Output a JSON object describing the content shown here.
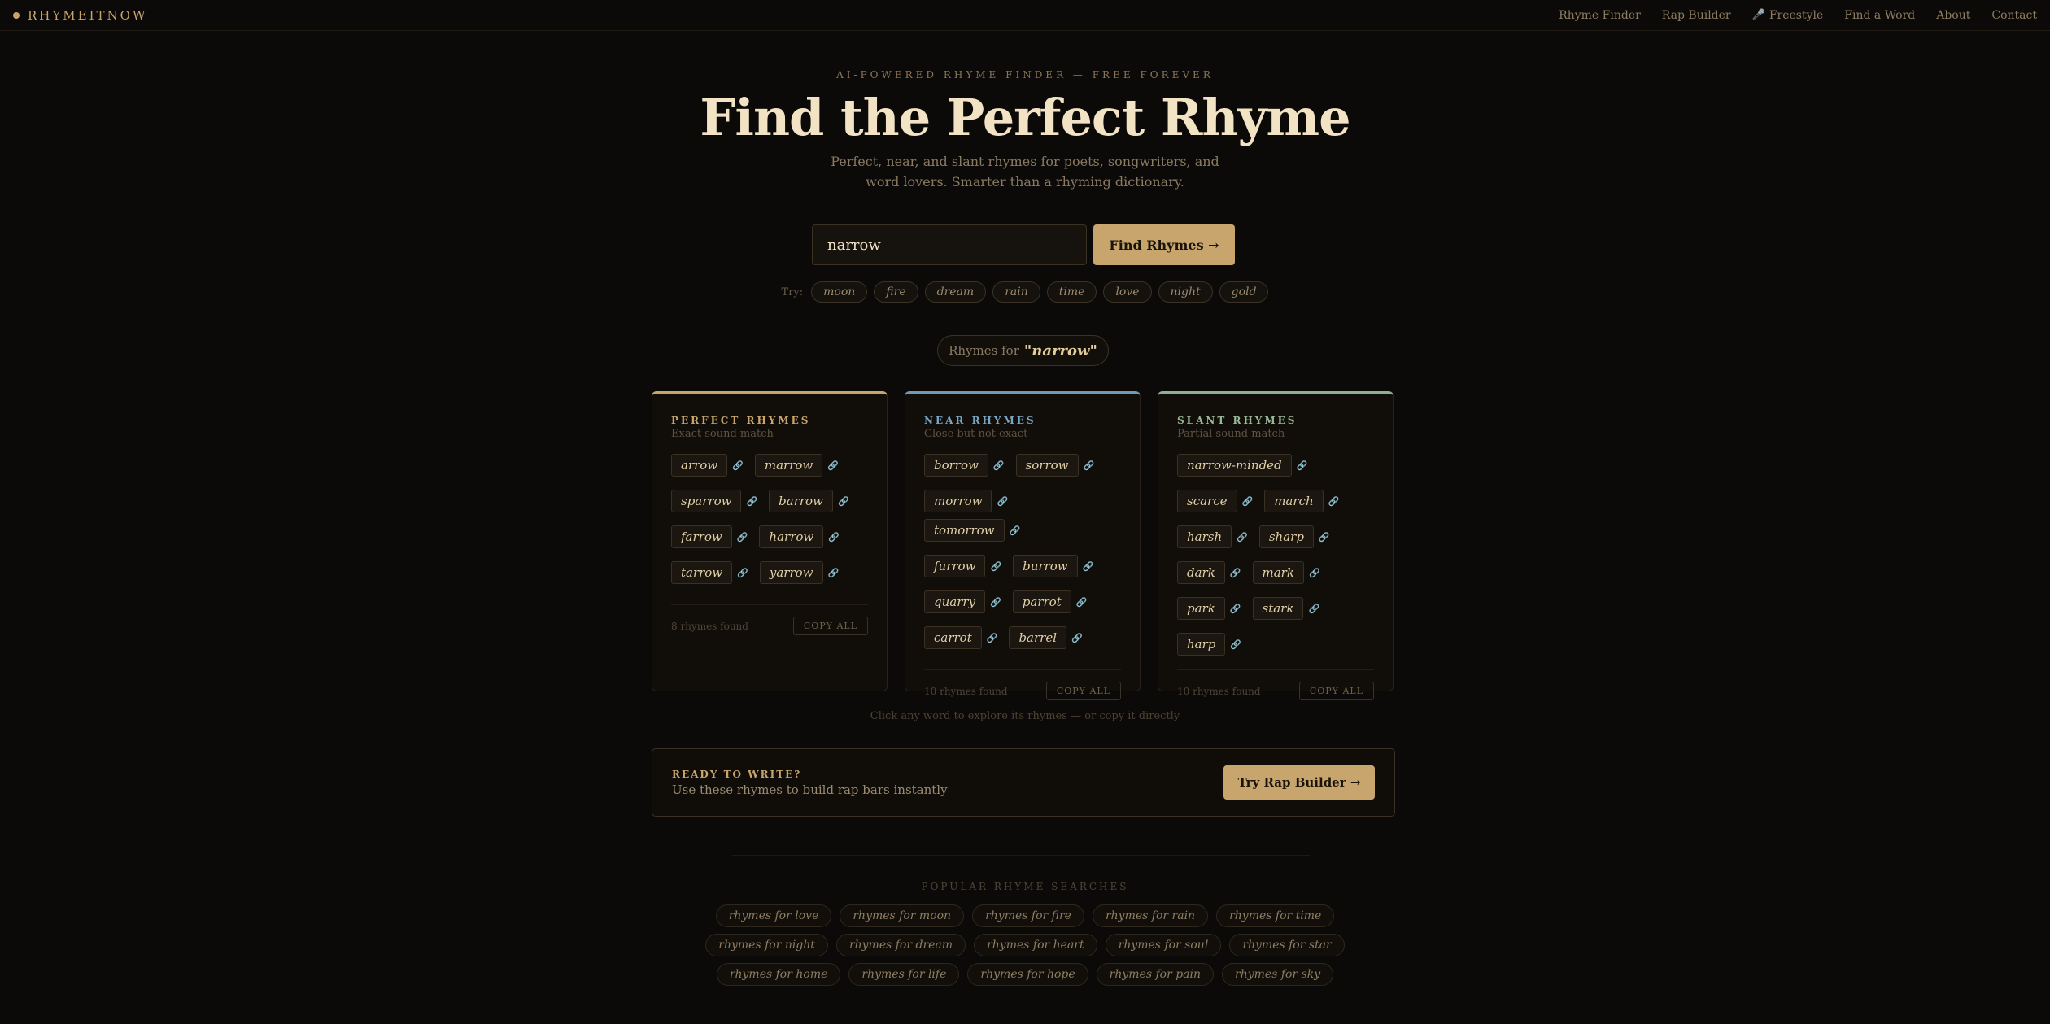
{
  "nav": {
    "brand": "RHYMEITNOW",
    "links": [
      {
        "label": "Rhyme Finder"
      },
      {
        "label": "Rap Builder"
      },
      {
        "label": "Freestyle",
        "icon": "microphone-icon"
      },
      {
        "label": "Find a Word"
      },
      {
        "label": "About"
      },
      {
        "label": "Contact"
      }
    ]
  },
  "hero": {
    "eyebrow": "AI-POWERED RHYME FINDER — FREE FOREVER",
    "title": "Find the Perfect Rhyme",
    "subtitle": "Perfect, near, and slant rhymes for poets, songwriters, and word lovers. Smarter than a rhyming dictionary."
  },
  "search": {
    "value": "narrow",
    "button": "Find Rhymes →",
    "try_label": "Try:",
    "suggestions": [
      "moon",
      "fire",
      "dream",
      "rain",
      "time",
      "love",
      "night",
      "gold"
    ]
  },
  "results": {
    "prefix": "Rhymes for",
    "query": "\"narrow\"",
    "hint": "Click any word to explore its rhymes — or copy it directly"
  },
  "cards": {
    "perfect": {
      "title": "PERFECT RHYMES",
      "subtitle": "Exact sound match",
      "words": [
        "arrow",
        "marrow",
        "sparrow",
        "barrow",
        "farrow",
        "harrow",
        "tarrow",
        "yarrow"
      ],
      "count": "8 rhymes found",
      "copy": "COPY ALL"
    },
    "near": {
      "title": "NEAR RHYMES",
      "subtitle": "Close but not exact",
      "words": [
        "borrow",
        "sorrow",
        "morrow",
        "tomorrow",
        "furrow",
        "burrow",
        "quarry",
        "parrot",
        "carrot",
        "barrel"
      ],
      "count": "10 rhymes found",
      "copy": "COPY ALL"
    },
    "slant": {
      "title": "SLANT RHYMES",
      "subtitle": "Partial sound match",
      "words": [
        "narrow-minded",
        "scarce",
        "march",
        "harsh",
        "sharp",
        "dark",
        "mark",
        "park",
        "stark",
        "harp"
      ],
      "count": "10 rhymes found",
      "copy": "COPY ALL"
    }
  },
  "cta": {
    "title": "READY TO WRITE?",
    "subtitle": "Use these rhymes to build rap bars instantly",
    "button": "Try Rap Builder →"
  },
  "popular": {
    "title": "POPULAR RHYME SEARCHES",
    "rows": [
      [
        "rhymes for love",
        "rhymes for moon",
        "rhymes for fire",
        "rhymes for rain",
        "rhymes for time"
      ],
      [
        "rhymes for night",
        "rhymes for dream",
        "rhymes for heart",
        "rhymes for soul",
        "rhymes for star"
      ],
      [
        "rhymes for home",
        "rhymes for life",
        "rhymes for hope",
        "rhymes for pain",
        "rhymes for sky"
      ]
    ]
  },
  "colors": {
    "background": "#0c0a08",
    "accent": "#c8a56c",
    "near": "#6b9bb8",
    "slant": "#8fb08e"
  }
}
